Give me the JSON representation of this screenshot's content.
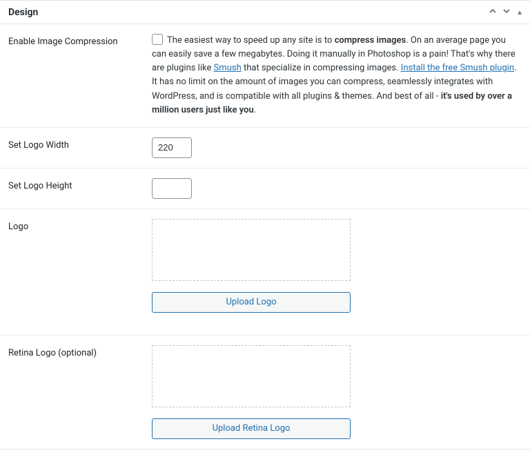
{
  "panel": {
    "title": "Design",
    "fields": {
      "enable_compression": {
        "label": "Enable Image Compression",
        "desc_part1": "The easiest way to speed up any site is to ",
        "desc_bold1": "compress images",
        "desc_part2": ". On an average page you can easily save a few megabytes. Doing it manually in Photoshop is a pain! That's why there are plugins like ",
        "link1_text": "Smush",
        "desc_part3": " that specialize in compressing images. ",
        "link2_text": "Install the free Smush plugin",
        "desc_part4": ". It has no limit on the amount of images you can compress, seamlessly integrates with WordPress, and is compatible with all plugins & themes. And best of all - ",
        "desc_bold2": "it's used by over a million users just like you",
        "desc_part5": "."
      },
      "logo_width": {
        "label": "Set Logo Width",
        "value": "220"
      },
      "logo_height": {
        "label": "Set Logo Height",
        "value": ""
      },
      "logo": {
        "label": "Logo",
        "button": "Upload Logo"
      },
      "retina_logo": {
        "label": "Retina Logo (optional)",
        "button": "Upload Retina Logo"
      }
    }
  }
}
